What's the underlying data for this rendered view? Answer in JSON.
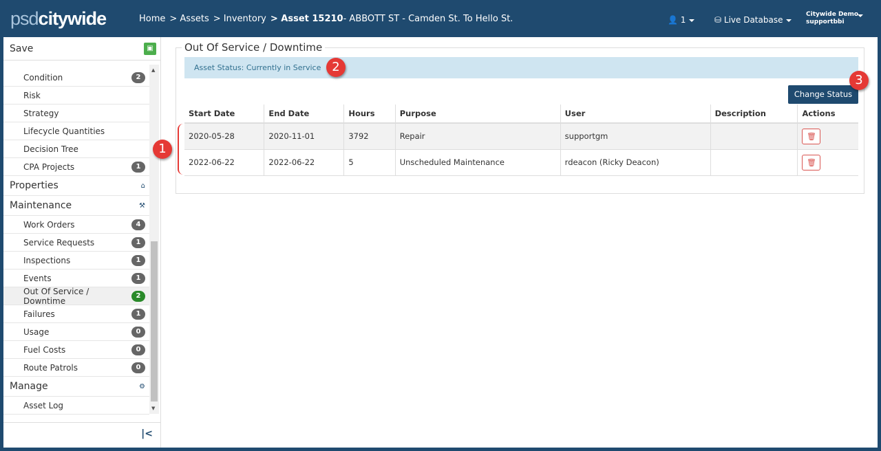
{
  "header": {
    "logo_light": "psd",
    "logo_bold": "citywide",
    "breadcrumb": [
      "Home",
      "> Assets",
      "> Inventory"
    ],
    "current_bold": "> Asset 15210",
    "current_rest": "- ABBOTT ST - Camden St. To Hello St.",
    "users_count": "1",
    "database": "Live Database",
    "user_org": "Citywide Demo",
    "user_name": "supportbbi"
  },
  "sidebar": {
    "save_label": "Save",
    "items": [
      {
        "label": "Condition",
        "badge": "2"
      },
      {
        "label": "Risk"
      },
      {
        "label": "Strategy"
      },
      {
        "label": "Lifecycle Quantities"
      },
      {
        "label": "Decision Tree"
      },
      {
        "label": "CPA Projects",
        "badge": "1"
      },
      {
        "label": "Properties",
        "section": true
      },
      {
        "label": "Maintenance",
        "section": true
      },
      {
        "label": "Work Orders",
        "badge": "4"
      },
      {
        "label": "Service Requests",
        "badge": "1"
      },
      {
        "label": "Inspections",
        "badge": "1"
      },
      {
        "label": "Events",
        "badge": "1"
      },
      {
        "label": "Out Of Service / Downtime",
        "badge": "2",
        "active": true
      },
      {
        "label": "Failures",
        "badge": "1"
      },
      {
        "label": "Usage",
        "badge": "0"
      },
      {
        "label": "Fuel Costs",
        "badge": "0"
      },
      {
        "label": "Route Patrols",
        "badge": "0"
      },
      {
        "label": "Manage",
        "section": true
      },
      {
        "label": "Asset Log"
      }
    ]
  },
  "main": {
    "title": "Out Of Service / Downtime",
    "status": "Asset Status: Currently in Service",
    "change_status": "Change Status",
    "columns": [
      "Start Date",
      "End Date",
      "Hours",
      "Purpose",
      "User",
      "Description",
      "Actions"
    ],
    "rows": [
      [
        "2020-05-28",
        "2020-11-01",
        "3792",
        "Repair",
        "supportgm",
        ""
      ],
      [
        "2022-06-22",
        "2022-06-22",
        "5",
        "Unscheduled Maintenance",
        "rdeacon (Ricky Deacon)",
        ""
      ]
    ]
  },
  "callouts": [
    "1",
    "2",
    "3"
  ]
}
